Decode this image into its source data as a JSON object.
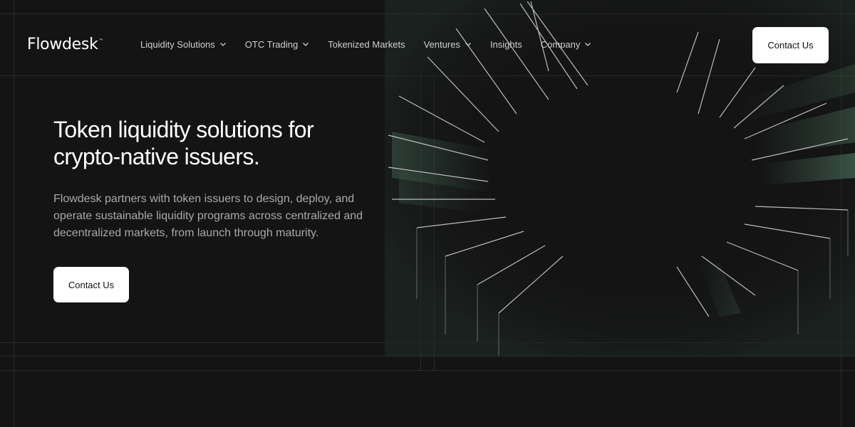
{
  "brand": {
    "logo_text": "Flowdesk",
    "logo_mark": "™"
  },
  "nav": {
    "items": [
      {
        "label": "Liquidity Solutions",
        "has_dropdown": true
      },
      {
        "label": "OTC Trading",
        "has_dropdown": true
      },
      {
        "label": "Tokenized Markets",
        "has_dropdown": false
      },
      {
        "label": "Ventures",
        "has_dropdown": true
      },
      {
        "label": "Insights",
        "has_dropdown": false
      },
      {
        "label": "Company",
        "has_dropdown": true
      }
    ],
    "cta_label": "Contact Us"
  },
  "hero": {
    "title_line1": "Token liquidity solutions for",
    "title_line2": "crypto-native issuers.",
    "subtitle": "Flowdesk partners with token issuers to design, deploy, and operate sustainable liquidity programs across centralized and decentralized markets, from launch through maturity.",
    "cta_label": "Contact Us"
  },
  "colors": {
    "background": "#141414",
    "cta_background": "#ffffff",
    "cta_text": "#111111",
    "nav_text": "#cfcfcf",
    "subtitle_text": "#a9a9a9",
    "accent_glow": "#3c5a4c"
  },
  "icons": {
    "dropdown": "chevron-down-icon"
  }
}
